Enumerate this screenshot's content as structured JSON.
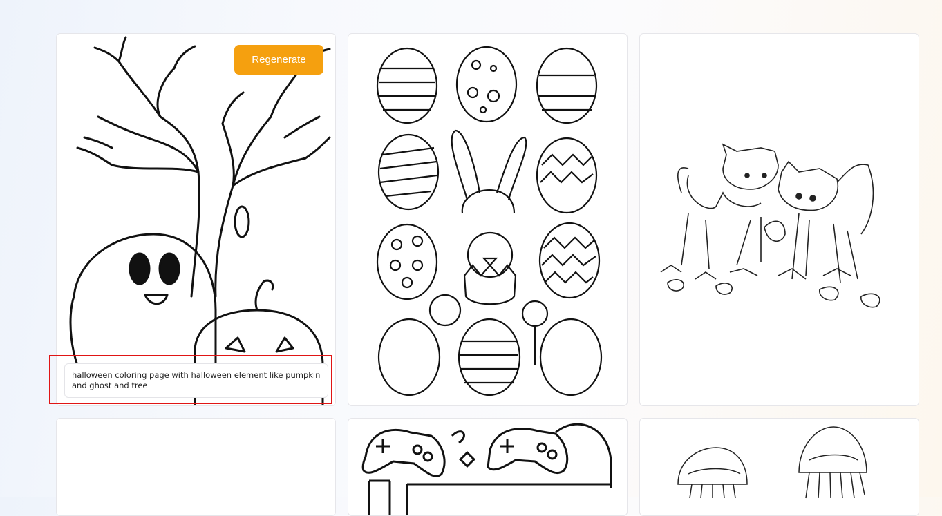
{
  "gallery": {
    "cards": [
      {
        "subject": "halloween",
        "regenerate_label": "Regenerate",
        "prompt": "halloween coloring page with halloween element like pumpkin and ghost and tree"
      },
      {
        "subject": "easter"
      },
      {
        "subject": "kittens"
      },
      {
        "subject": "blank"
      },
      {
        "subject": "gamer"
      },
      {
        "subject": "jellyfish"
      }
    ]
  }
}
